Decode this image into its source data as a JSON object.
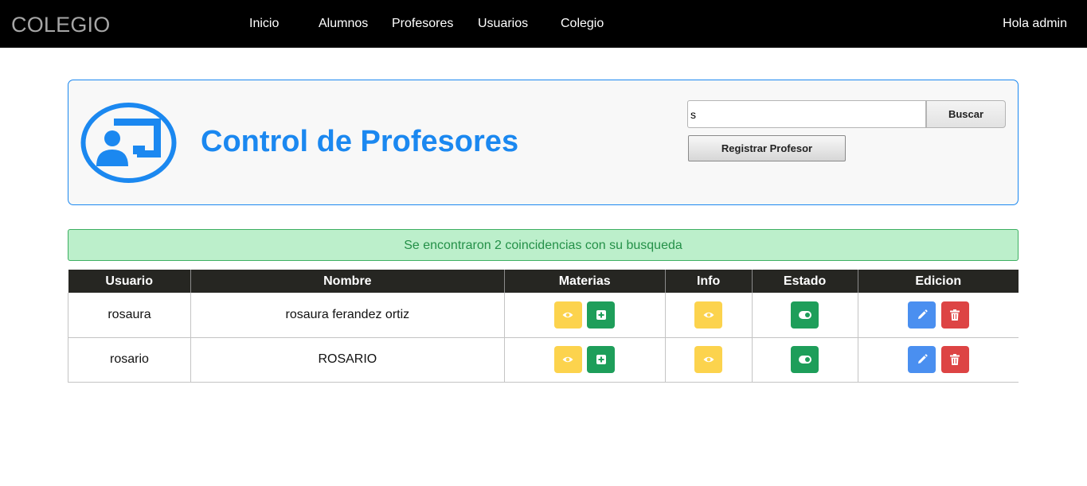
{
  "navbar": {
    "brand": "COLEGIO",
    "links": [
      {
        "label": "Inicio"
      },
      {
        "label": "Alumnos"
      },
      {
        "label": "Profesores"
      },
      {
        "label": "Usuarios"
      },
      {
        "label": "Colegio"
      }
    ],
    "greeting": "Hola admin"
  },
  "panel": {
    "title": "Control de Profesores",
    "logo_icon": "teacher-board-icon",
    "search_value": "s",
    "search_button": "Buscar",
    "register_button": "Registrar Profesor"
  },
  "alert": {
    "message": "Se encontraron 2 coincidencias con su busqueda"
  },
  "table": {
    "headers": [
      "Usuario",
      "Nombre",
      "Materias",
      "Info",
      "Estado",
      "Edicion"
    ],
    "rows": [
      {
        "usuario": "rosaura",
        "nombre": "rosaura ferandez ortiz"
      },
      {
        "usuario": "rosario",
        "nombre": "ROSARIO"
      }
    ]
  },
  "colors": {
    "navbar": "#000000",
    "accent": "#1b88f0",
    "alert_bg": "#bcefcb",
    "alert_text": "#249048",
    "table_header": "#262622",
    "view_button": "#fcd34d",
    "add_button": "#1e9e5a",
    "edit_button": "#4a8ff0",
    "delete_button": "#dd4444"
  }
}
